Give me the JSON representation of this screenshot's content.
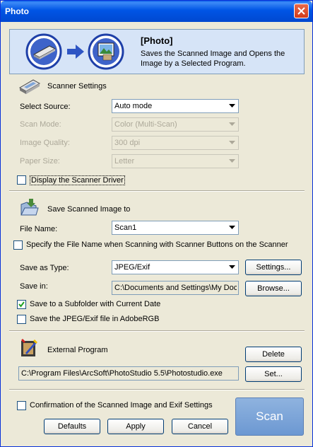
{
  "window": {
    "title": "Photo"
  },
  "header": {
    "title": "[Photo]",
    "description": "Saves the Scanned Image and Opens the Image by a Selected Program."
  },
  "scanner_settings": {
    "heading": "Scanner Settings",
    "select_source_label": "Select Source:",
    "select_source_value": "Auto mode",
    "scan_mode_label": "Scan Mode:",
    "scan_mode_value": "Color (Multi-Scan)",
    "image_quality_label": "Image Quality:",
    "image_quality_value": "300 dpi",
    "paper_size_label": "Paper Size:",
    "paper_size_value": "Letter",
    "display_driver_label": "Display the Scanner Driver"
  },
  "save_settings": {
    "heading": "Save Scanned Image to",
    "file_name_label": "File Name:",
    "file_name_value": "Scan1",
    "specify_label": "Specify the File Name when Scanning with Scanner Buttons on the Scanner",
    "save_type_label": "Save as Type:",
    "save_type_value": "JPEG/Exif",
    "settings_button": "Settings...",
    "save_in_label": "Save in:",
    "save_in_value": "C:\\Documents and Settings\\My Doc",
    "browse_button": "Browse...",
    "subfolder_label": "Save to a Subfolder with Current Date",
    "adobergb_label": "Save the JPEG/Exif file in AdobeRGB"
  },
  "external_program": {
    "heading": "External Program",
    "path": "C:\\Program Files\\ArcSoft\\PhotoStudio 5.5\\Photostudio.exe",
    "delete_button": "Delete",
    "set_button": "Set..."
  },
  "footer": {
    "confirm_label": "Confirmation of the Scanned Image and Exif Settings",
    "scan_button": "Scan",
    "defaults_button": "Defaults",
    "apply_button": "Apply",
    "cancel_button": "Cancel"
  },
  "states": {
    "display_driver_checked": false,
    "specify_checked": false,
    "subfolder_checked": true,
    "adobergb_checked": false,
    "confirm_checked": false
  }
}
